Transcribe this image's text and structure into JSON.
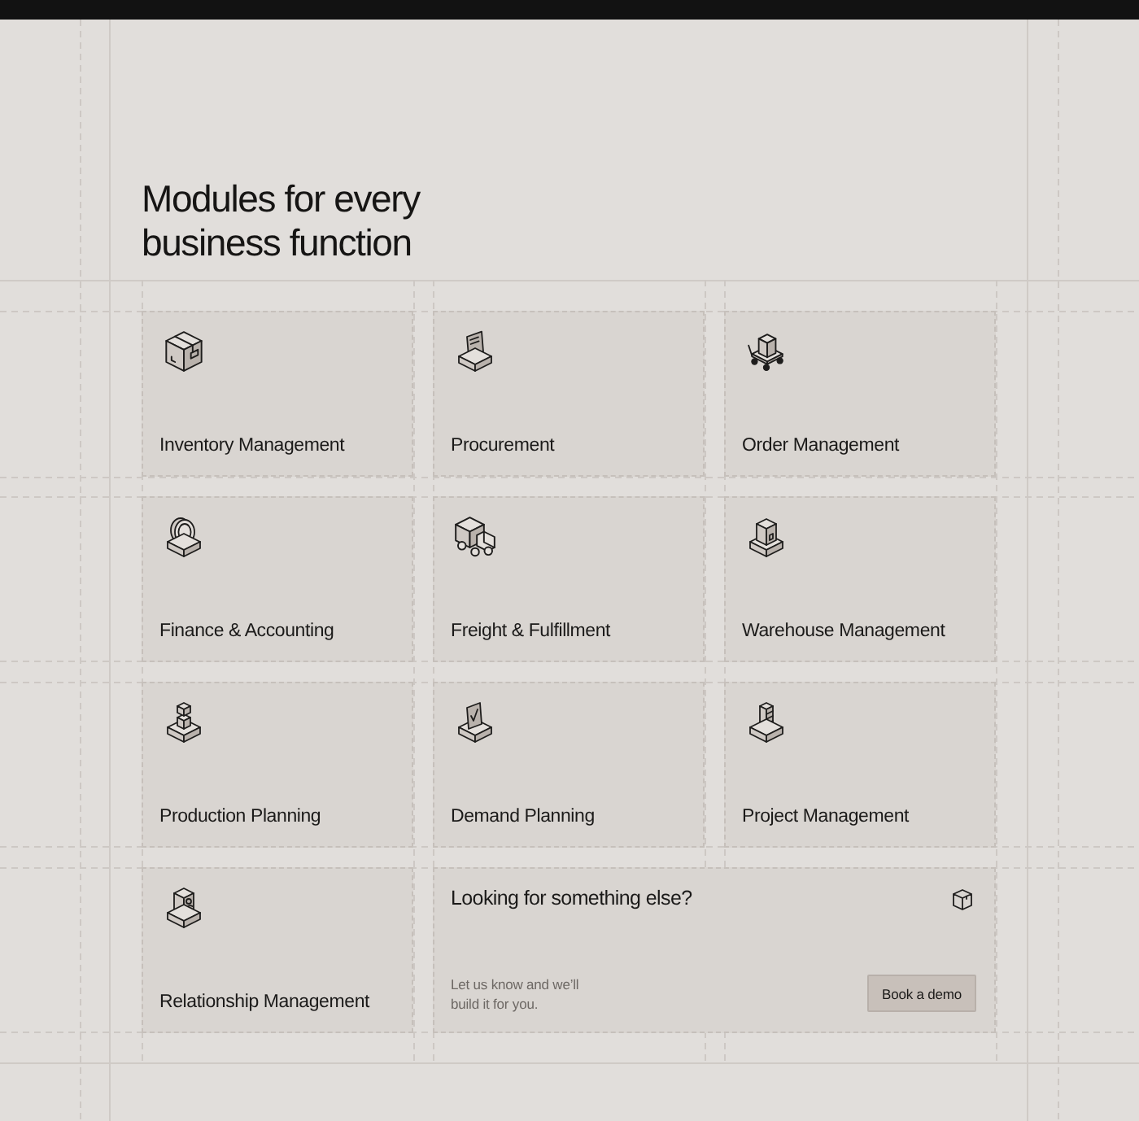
{
  "heading": "Modules for every business function",
  "modules": [
    {
      "label": "Inventory Management"
    },
    {
      "label": "Procurement"
    },
    {
      "label": "Order Management"
    },
    {
      "label": "Finance & Accounting"
    },
    {
      "label": "Freight & Fulfillment"
    },
    {
      "label": "Warehouse Management"
    },
    {
      "label": "Production Planning"
    },
    {
      "label": "Demand Planning"
    },
    {
      "label": "Project Management"
    },
    {
      "label": "Relationship Management"
    }
  ],
  "cta": {
    "title": "Looking for something else?",
    "text": "Let us know and we’ll build it for you.",
    "button": "Book a demo"
  }
}
